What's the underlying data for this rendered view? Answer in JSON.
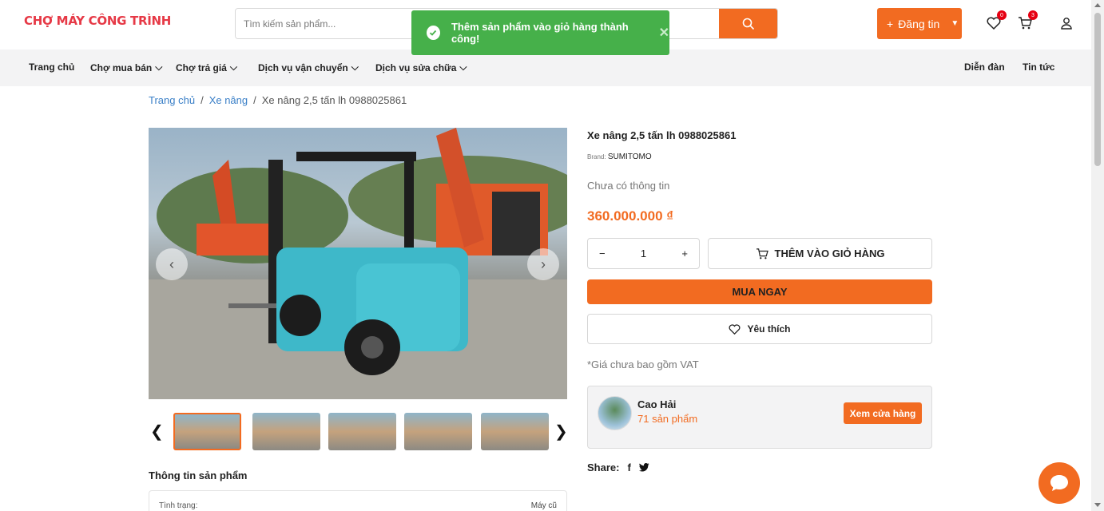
{
  "header": {
    "logo_text": "CHỢ MÁY CÔNG TRÌNH",
    "search_placeholder": "Tìm kiếm sản phẩm...",
    "post_label": "Đăng tin",
    "wishlist_count": "0",
    "cart_count": "3"
  },
  "toast": {
    "message": "Thêm sản phẩm vào giỏ hàng thành công!"
  },
  "nav": {
    "items": [
      "Trang chủ",
      "Chợ mua bán",
      "Chợ trả giá",
      "Dịch vụ vận chuyển",
      "Dịch vụ sửa chữa"
    ],
    "right_items": [
      "Diễn đàn",
      "Tin tức"
    ]
  },
  "breadcrumb": {
    "home": "Trang chủ",
    "category": "Xe nâng",
    "current": "Xe nâng 2,5 tấn lh 0988025861"
  },
  "product": {
    "title": "Xe nâng 2,5 tấn lh 0988025861",
    "brand_label": "Brand:",
    "brand": "SUMITOMO",
    "description": "Chưa có thông tin",
    "price": "360.000.000 ₫",
    "quantity": "1",
    "add_to_cart": "THÊM VÀO GIỎ HÀNG",
    "buy_now": "MUA NGAY",
    "wishlist": "Yêu thích",
    "vat_note": "*Giá chưa bao gồm VAT"
  },
  "shop": {
    "name": "Cao Hải",
    "product_count": "71 sản phẩm",
    "view_shop": "Xem cửa hàng"
  },
  "share": {
    "label": "Share:"
  },
  "info": {
    "title": "Thông tin sản phẩm",
    "condition_label": "Tình trạng:",
    "condition_value": "Máy cũ"
  },
  "colors": {
    "accent": "#f26b21",
    "toast_bg": "#46b04a",
    "link": "#3a7fc7"
  }
}
